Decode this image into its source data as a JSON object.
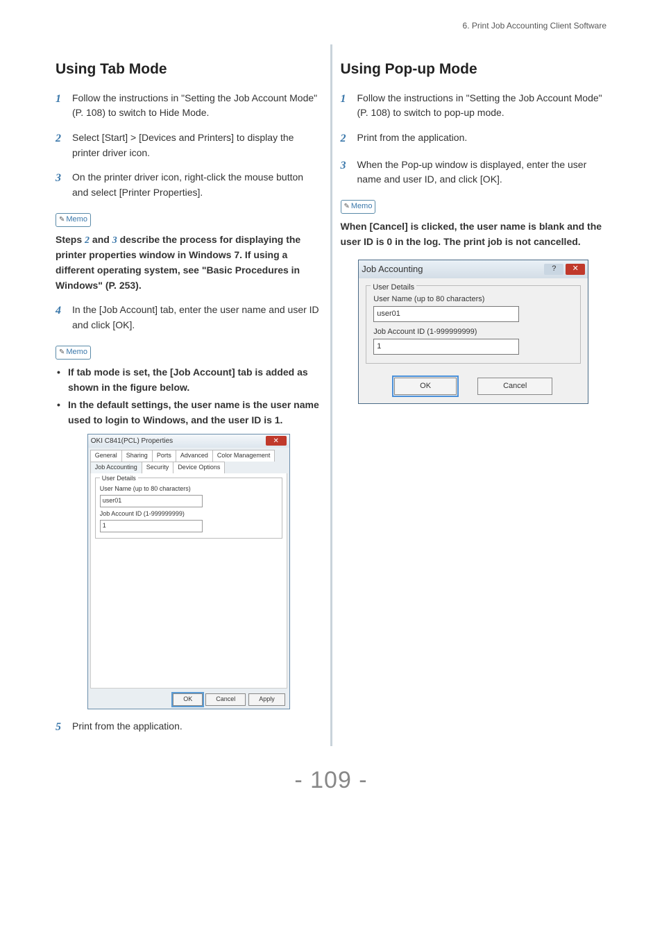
{
  "header": "6. Print Job Accounting Client Software",
  "page_number": "- 109 -",
  "memo_label": "Memo",
  "left": {
    "heading": "Using Tab Mode",
    "steps": [
      "Follow the instructions in \"Setting the Job Account Mode\" (P. 108) to switch to Hide Mode.",
      "Select [Start] > [Devices and Printers] to display the printer driver icon.",
      "On the printer driver icon, right-click the mouse button and select [Printer Properties]."
    ],
    "memo1_pre": "Steps ",
    "memo1_mid1": "2",
    "memo1_mid2": " and ",
    "memo1_mid3": "3",
    "memo1_post": " describe the process for displaying the printer properties window in Windows 7. If using a different operating system, see \"Basic Procedures in Windows\" (P. 253).",
    "step4": "In the [Job Account] tab, enter the user name and user ID and click [OK].",
    "bullets": [
      "If tab mode is set, the [Job Account] tab is added as shown in the figure below.",
      "In the default settings, the user name is the user name used to login to Windows, and the user ID is 1."
    ],
    "shot": {
      "title": "OKI C841(PCL) Properties",
      "tabs_row1": [
        "General",
        "Sharing",
        "Ports",
        "Advanced",
        "Color Management"
      ],
      "tabs_row2": [
        "Job Accounting",
        "Security",
        "Device Options"
      ],
      "fieldset_legend": "User Details",
      "uname_label": "User Name (up to 80 characters)",
      "uname_value": "user01",
      "jobid_label": "Job Account ID (1-999999999)",
      "jobid_value": "1",
      "btn_ok": "OK",
      "btn_cancel": "Cancel",
      "btn_apply": "Apply"
    },
    "step5": "Print from the application."
  },
  "right": {
    "heading": "Using Pop-up Mode",
    "steps": [
      "Follow the instructions in \"Setting the Job Account Mode\" (P. 108) to switch to pop-up mode.",
      "Print from the application.",
      "When the Pop-up window is displayed, enter the user name and user ID, and click [OK]."
    ],
    "memo": "When [Cancel] is clicked, the user name is blank and the user ID is 0 in the log. The print job is not cancelled.",
    "shot": {
      "title": "Job Accounting",
      "fieldset_legend": "User Details",
      "uname_label": "User Name (up to 80 characters)",
      "uname_value": "user01",
      "jobid_label": "Job Account ID (1-999999999)",
      "jobid_value": "1",
      "btn_ok": "OK",
      "btn_cancel": "Cancel"
    }
  }
}
